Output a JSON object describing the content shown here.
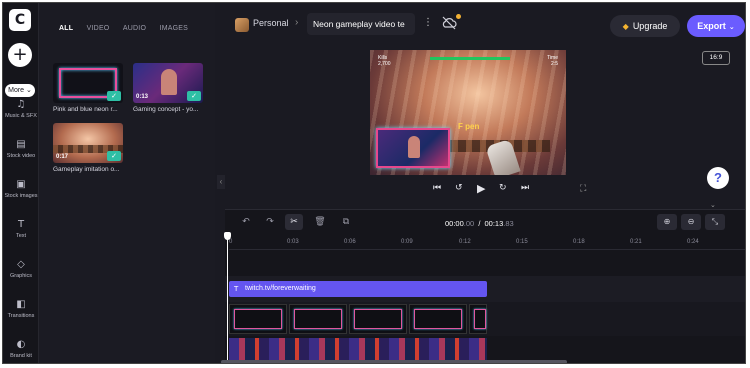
{
  "app": {
    "logo_letter": "C"
  },
  "rail": {
    "add_label": "+",
    "more_label": "More ⌄",
    "items": [
      {
        "id": "music",
        "label": "Music & SFX",
        "icon": "music-note-icon",
        "glyph": "♫"
      },
      {
        "id": "stock-video",
        "label": "Stock video",
        "icon": "film-icon",
        "glyph": "▤"
      },
      {
        "id": "stock-images",
        "label": "Stock images",
        "icon": "image-icon",
        "glyph": "▣"
      },
      {
        "id": "text",
        "label": "Text",
        "icon": "text-icon",
        "glyph": "T"
      },
      {
        "id": "graphics",
        "label": "Graphics",
        "icon": "shapes-icon",
        "glyph": "◇"
      },
      {
        "id": "transitions",
        "label": "Transitions",
        "icon": "transition-icon",
        "glyph": "◧"
      },
      {
        "id": "brand-kit",
        "label": "Brand kit",
        "icon": "brand-kit-icon",
        "glyph": "◐"
      }
    ]
  },
  "media": {
    "tabs": [
      "ALL",
      "VIDEO",
      "AUDIO",
      "IMAGES"
    ],
    "active_tab": "ALL",
    "items": [
      {
        "title": "Pink and blue neon r...",
        "duration": "",
        "checked": true
      },
      {
        "title": "Gaming concept - yo...",
        "duration": "0:13",
        "checked": true
      },
      {
        "title": "Gameplay imitation o...",
        "duration": "0:17",
        "checked": true
      }
    ]
  },
  "topbar": {
    "workspace": "Personal",
    "separator": "›",
    "project_title": "Neon gameplay video te",
    "upgrade_label": "Upgrade",
    "export_label": "Export",
    "aspect_ratio": "16:9"
  },
  "preview": {
    "overlay_text": "F   pen",
    "hud_left": "Kills\n2,700",
    "hud_right": "Time\n2:5"
  },
  "timeline": {
    "current_time": "00:00",
    "current_frac": ".00",
    "total_time": "00:13",
    "total_frac": ".83",
    "ruler": [
      "0",
      "0:03",
      "0:06",
      "0:09",
      "0:12",
      "0:15",
      "0:18",
      "0:21",
      "0:24"
    ],
    "text_clip_label": "twitch.tv/foreverwaiting",
    "frame_clip_count": 5
  },
  "colors": {
    "accent": "#6b5cff",
    "text_clip": "#6455f0",
    "check": "#2ebfa5",
    "upgrade_gem": "#f4b430"
  }
}
